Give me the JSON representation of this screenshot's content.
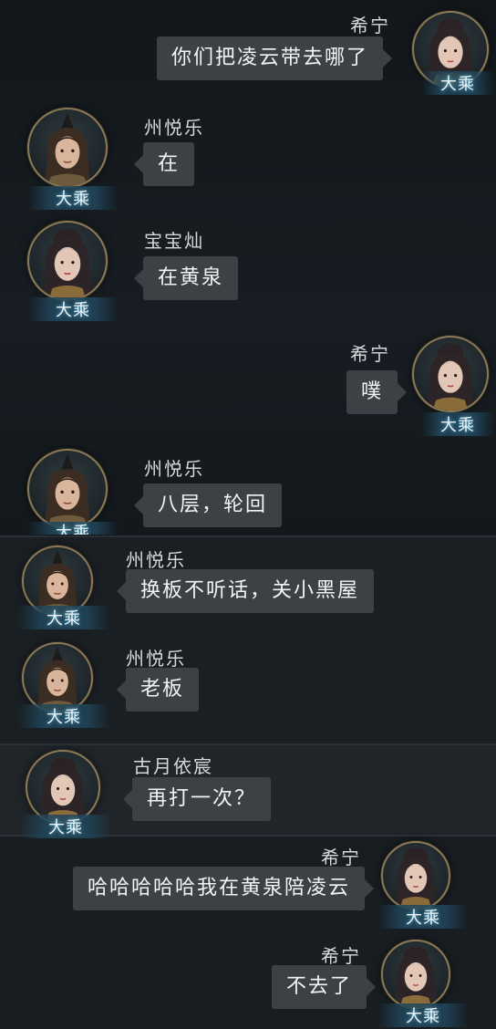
{
  "messages": [
    {
      "sender": "希宁",
      "rank": "大乘",
      "text": "你们把凌云带去哪了",
      "side": "right",
      "avatar_icon": "female-avatar-icon"
    },
    {
      "sender": "州悦乐",
      "rank": "大乘",
      "text": "在",
      "side": "left",
      "avatar_icon": "male-avatar-icon"
    },
    {
      "sender": "宝宝灿",
      "rank": "大乘",
      "text": "在黄泉",
      "side": "left",
      "avatar_icon": "female-avatar-icon"
    },
    {
      "sender": "希宁",
      "rank": "大乘",
      "text": "噗",
      "side": "right",
      "avatar_icon": "female-avatar-icon"
    },
    {
      "sender": "州悦乐",
      "rank": "大乘",
      "text": "八层，轮回",
      "side": "left",
      "avatar_icon": "male-avatar-icon"
    },
    {
      "sender": "州悦乐",
      "rank": "大乘",
      "text": "换板不听话，关小黑屋",
      "side": "left",
      "avatar_icon": "male-avatar-icon"
    },
    {
      "sender": "州悦乐",
      "rank": "大乘",
      "text": "老板",
      "side": "left",
      "avatar_icon": "male-avatar-icon"
    },
    {
      "sender": "古月依宸",
      "rank": "大乘",
      "text": "再打一次？",
      "side": "left",
      "avatar_icon": "female-avatar-icon"
    },
    {
      "sender": "希宁",
      "rank": "大乘",
      "text": "哈哈哈哈哈我在黄泉陪凌云",
      "side": "right",
      "avatar_icon": "female-avatar-icon"
    },
    {
      "sender": "希宁",
      "rank": "大乘",
      "text": "不去了",
      "side": "right",
      "avatar_icon": "female-avatar-icon"
    }
  ],
  "colors": {
    "background": "#12171b",
    "bubble": "#3d4145",
    "avatar_ring": "#8b7a55",
    "rank_glow": "#5fc0e8"
  }
}
